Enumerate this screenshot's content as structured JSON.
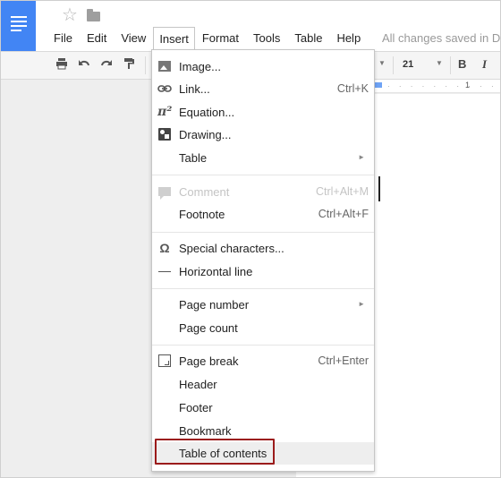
{
  "app": {
    "logo": "docs-logo-icon",
    "icons": [
      "star-icon",
      "folder-icon"
    ]
  },
  "menubar": {
    "items": [
      "File",
      "Edit",
      "View",
      "Insert",
      "Format",
      "Tools",
      "Table",
      "Help"
    ],
    "open_item": "Insert",
    "status": "All changes saved in D"
  },
  "toolbar": {
    "icons": [
      "print-icon",
      "undo-icon",
      "redo-icon",
      "paint-format-icon"
    ],
    "font_size": "21",
    "bold_label": "B",
    "italic_label": "I"
  },
  "ruler": {
    "number": "1"
  },
  "insert_menu": {
    "items": [
      {
        "label": "Image...",
        "shortcut": "",
        "icon": "image-icon",
        "submenu": false,
        "disabled": false
      },
      {
        "label": "Link...",
        "shortcut": "Ctrl+K",
        "icon": "link-icon",
        "submenu": false,
        "disabled": false
      },
      {
        "label": "Equation...",
        "shortcut": "",
        "icon": "equation-icon",
        "submenu": false,
        "disabled": false
      },
      {
        "label": "Drawing...",
        "shortcut": "",
        "icon": "drawing-icon",
        "submenu": false,
        "disabled": false
      },
      {
        "label": "Table",
        "shortcut": "",
        "icon": "",
        "submenu": true,
        "disabled": false
      },
      {
        "label": "Comment",
        "shortcut": "Ctrl+Alt+M",
        "icon": "comment-icon",
        "submenu": false,
        "disabled": true
      },
      {
        "label": "Footnote",
        "shortcut": "Ctrl+Alt+F",
        "icon": "",
        "submenu": false,
        "disabled": false
      },
      {
        "label": "Special characters...",
        "shortcut": "",
        "icon": "omega-icon",
        "submenu": false,
        "disabled": false
      },
      {
        "label": "Horizontal line",
        "shortcut": "",
        "icon": "horizontal-line-icon",
        "submenu": false,
        "disabled": false
      },
      {
        "label": "Page number",
        "shortcut": "",
        "icon": "",
        "submenu": true,
        "disabled": false
      },
      {
        "label": "Page count",
        "shortcut": "",
        "icon": "",
        "submenu": false,
        "disabled": false
      },
      {
        "label": "Page break",
        "shortcut": "Ctrl+Enter",
        "icon": "page-break-icon",
        "submenu": false,
        "disabled": false
      },
      {
        "label": "Header",
        "shortcut": "",
        "icon": "",
        "submenu": false,
        "disabled": false
      },
      {
        "label": "Footer",
        "shortcut": "",
        "icon": "",
        "submenu": false,
        "disabled": false
      },
      {
        "label": "Bookmark",
        "shortcut": "",
        "icon": "",
        "submenu": false,
        "disabled": false
      },
      {
        "label": "Table of contents",
        "shortcut": "",
        "icon": "",
        "submenu": false,
        "disabled": false,
        "highlighted": true
      }
    ]
  },
  "colors": {
    "brand": "#4285f4",
    "highlight_box": "#9b1b1b",
    "disabled_text": "#c4c4c4"
  }
}
